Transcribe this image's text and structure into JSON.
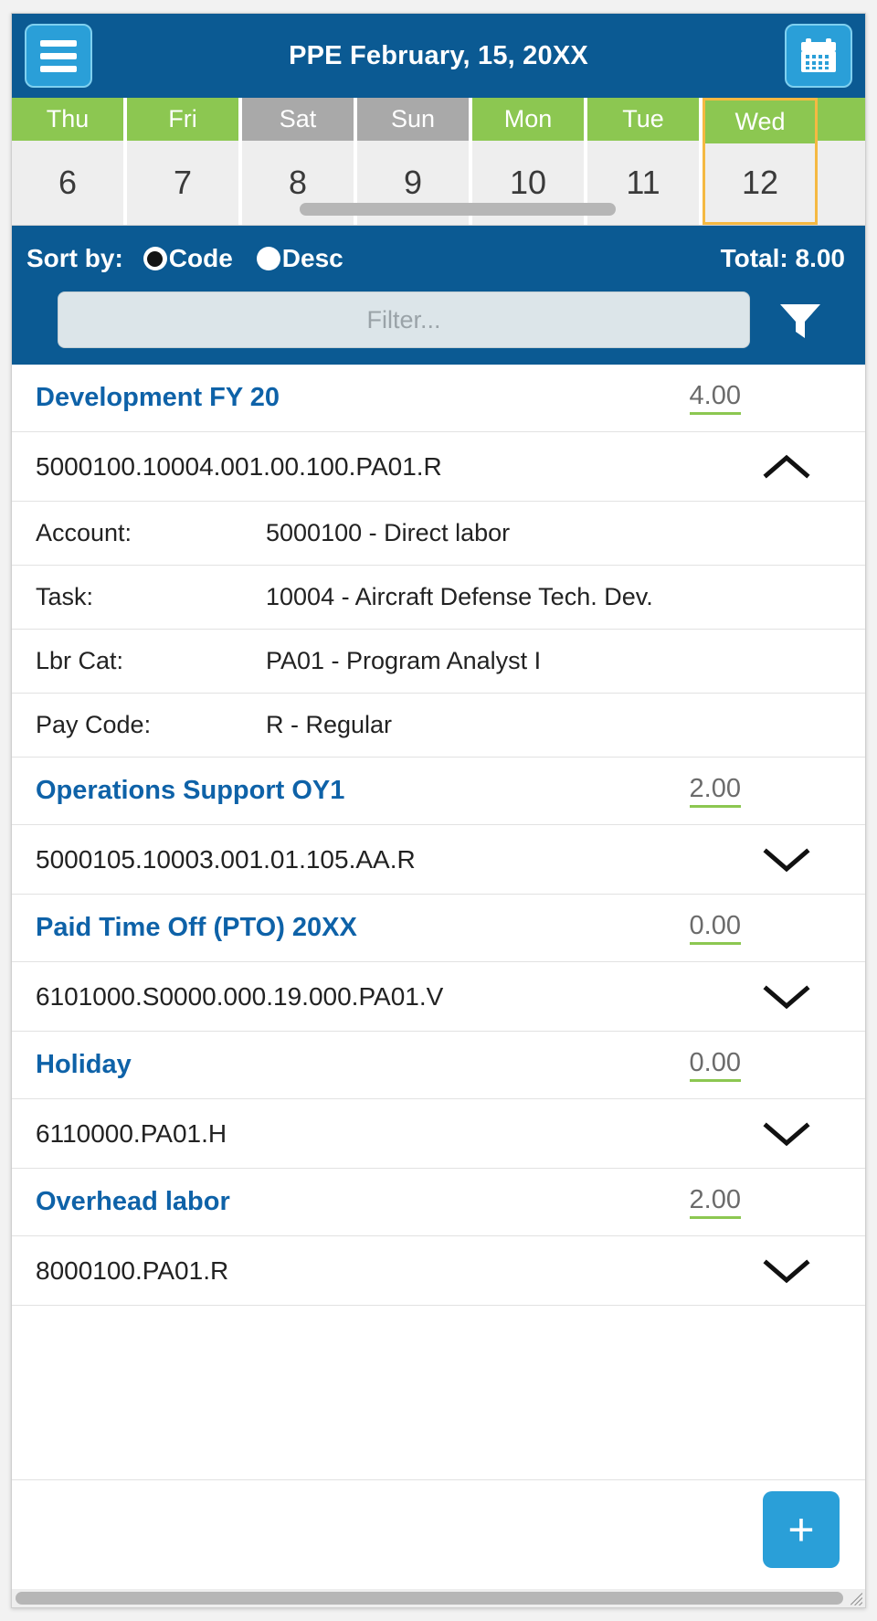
{
  "header": {
    "title": "PPE February, 15, 20XX",
    "menu_icon": "hamburger-menu-icon",
    "calendar_icon": "calendar-icon"
  },
  "day_strip": {
    "days": [
      {
        "dow": "Thu",
        "num": "6",
        "weekend": false,
        "selected": false
      },
      {
        "dow": "Fri",
        "num": "7",
        "weekend": false,
        "selected": false
      },
      {
        "dow": "Sat",
        "num": "8",
        "weekend": true,
        "selected": false
      },
      {
        "dow": "Sun",
        "num": "9",
        "weekend": true,
        "selected": false
      },
      {
        "dow": "Mon",
        "num": "10",
        "weekend": false,
        "selected": false
      },
      {
        "dow": "Tue",
        "num": "11",
        "weekend": false,
        "selected": false
      },
      {
        "dow": "Wed",
        "num": "12",
        "weekend": false,
        "selected": true
      },
      {
        "dow": "",
        "num": "",
        "weekend": false,
        "selected": false
      }
    ]
  },
  "sort": {
    "label": "Sort by:",
    "options": [
      {
        "label": "Code",
        "selected": true
      },
      {
        "label": "Desc",
        "selected": false
      }
    ],
    "total_label": "Total: 8.00"
  },
  "filter": {
    "placeholder": "Filter...",
    "value": "",
    "funnel_icon": "filter-funnel-icon"
  },
  "detail_labels": {
    "account": "Account:",
    "task": "Task:",
    "lbr_cat": "Lbr Cat:",
    "pay_code": "Pay Code:"
  },
  "groups": [
    {
      "name": "Development FY 20",
      "hours": "4.00",
      "code": "5000100.10004.001.00.100.PA01.R",
      "expanded": true,
      "details": {
        "account": "5000100 - Direct labor",
        "task": "10004 - Aircraft Defense Tech. Dev.",
        "lbr_cat": "PA01 - Program Analyst I",
        "pay_code": "R - Regular"
      }
    },
    {
      "name": "Operations Support OY1",
      "hours": "2.00",
      "code": "5000105.10003.001.01.105.AA.R",
      "expanded": false
    },
    {
      "name": "Paid Time Off (PTO) 20XX",
      "hours": "0.00",
      "code": "6101000.S0000.000.19.000.PA01.V",
      "expanded": false
    },
    {
      "name": "Holiday",
      "hours": "0.00",
      "code": "6110000.PA01.H",
      "expanded": false
    },
    {
      "name": "Overhead labor",
      "hours": "2.00",
      "code": "8000100.PA01.R",
      "expanded": false
    }
  ],
  "footer": {
    "add_label": "+"
  },
  "colors": {
    "header_blue": "#0b5a93",
    "button_blue": "#2a9fd8",
    "weekday_green": "#8cc751",
    "weekend_gray": "#a9a9a9",
    "selected_border": "#f5b942",
    "group_link_blue": "#0e62a8"
  }
}
